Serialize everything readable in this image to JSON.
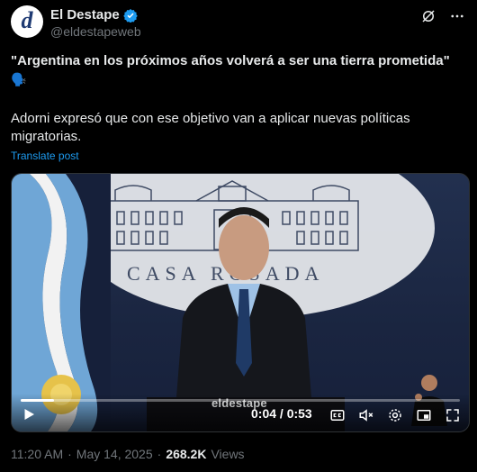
{
  "author": {
    "display_name": "El Destape",
    "handle": "@eldestapeweb",
    "avatar_letter": "d",
    "verified_color": "#1d9bf0"
  },
  "header_icons": [
    "grok-icon",
    "more-icon"
  ],
  "post": {
    "quote": "\"Argentina en los próximos años volverá a ser una tierra prometida\"",
    "emoji": "🗣️",
    "body": "Adorni expresó que con ese objetivo van a aplicar nuevas políticas migratorias.",
    "translate_label": "Translate post"
  },
  "video": {
    "building_text": "CASA ROSADA",
    "watermark": "eldestape",
    "time_display": "0:04 / 0:53",
    "progress_fraction": 0.075
  },
  "footer": {
    "time": "11:20 AM",
    "separator": "·",
    "date": "May 14, 2025",
    "views_count": "268.2K",
    "views_label": "Views"
  },
  "colors": {
    "accent": "#1d9bf0",
    "background": "#000000",
    "text": "#e7e9ea",
    "muted": "#71767b"
  }
}
